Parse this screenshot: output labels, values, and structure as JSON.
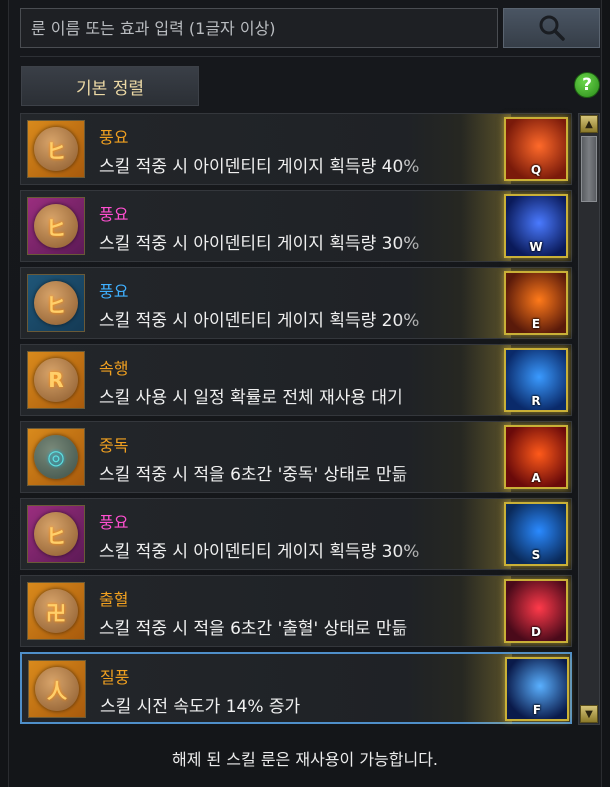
{
  "search": {
    "placeholder": "룬 이름 또는 효과 입력 (1글자 이상)",
    "button_icon": "search-icon"
  },
  "sort_button": {
    "label": "기본 정렬"
  },
  "help_button": {
    "label": "?"
  },
  "colors": {
    "orange_name": "#f0a020",
    "pink_name": "#ff4fd0",
    "blue_name": "#3fb0ff",
    "selected_border": "#4f8fc9"
  },
  "runes": [
    {
      "name": "풍요",
      "name_color": "#f0a020",
      "rune_bg": "orange",
      "glyph": "ヒ",
      "desc": "스킬 적중 시 아이덴티티 게이지 획득량 40%",
      "skill_key": "Q",
      "skill_colors": [
        "#7a1a0a",
        "#ff6a2a"
      ]
    },
    {
      "name": "풍요",
      "name_color": "#ff4fd0",
      "rune_bg": "purple",
      "glyph": "ヒ",
      "desc": "스킬 적중 시 아이덴티티 게이지 획득량 30%",
      "skill_key": "W",
      "skill_colors": [
        "#0a1a5a",
        "#4a7aff"
      ]
    },
    {
      "name": "풍요",
      "name_color": "#3fb0ff",
      "rune_bg": "blue",
      "glyph": "ヒ",
      "desc": "스킬 적중 시 아이덴티티 게이지 획득량 20%",
      "skill_key": "E",
      "skill_colors": [
        "#5a1a0a",
        "#ff7a1a"
      ]
    },
    {
      "name": "속행",
      "name_color": "#f0a020",
      "rune_bg": "orange",
      "glyph": "R",
      "desc": "스킬 사용 시 일정 확률로 전체 재사용 대기",
      "skill_key": "R",
      "skill_colors": [
        "#0a2a6a",
        "#3a9aff"
      ]
    },
    {
      "name": "중독",
      "name_color": "#f0a020",
      "rune_bg": "orange",
      "glyph": "◎",
      "teal": true,
      "desc": "스킬 적중 시 적을 6초간 '중독' 상태로 만듦",
      "skill_key": "A",
      "skill_colors": [
        "#6a0a0a",
        "#ff5a1a"
      ]
    },
    {
      "name": "풍요",
      "name_color": "#ff4fd0",
      "rune_bg": "purple",
      "glyph": "ヒ",
      "desc": "스킬 적중 시 아이덴티티 게이지 획득량 30%",
      "skill_key": "S",
      "skill_colors": [
        "#0a2a5a",
        "#2a8aff"
      ]
    },
    {
      "name": "출혈",
      "name_color": "#f0a020",
      "rune_bg": "orange",
      "glyph": "卍",
      "desc": "스킬 적중 시 적을 6초간 '출혈' 상태로 만듦",
      "skill_key": "D",
      "skill_colors": [
        "#4a0a1a",
        "#ff3a4a"
      ]
    },
    {
      "name": "질풍",
      "name_color": "#f0a020",
      "rune_bg": "orange",
      "glyph": "人",
      "desc": "스킬 시전 속도가 14% 증가",
      "skill_key": "F",
      "skill_colors": [
        "#0a1a4a",
        "#5ab0ff"
      ],
      "selected": true
    }
  ],
  "footer": {
    "note": "해제 된 스킬 룬은 재사용이 가능합니다."
  }
}
